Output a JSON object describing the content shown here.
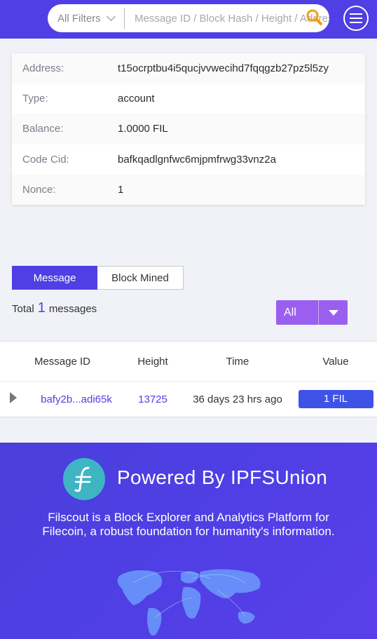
{
  "header": {
    "filter_label": "All Filters",
    "search_placeholder": "Message ID / Block Hash / Height / Address"
  },
  "info": [
    {
      "label": "Address:",
      "value": "t15ocrptbu4i5qucjvvwecihd7fqqgzb27pz5l5zy"
    },
    {
      "label": "Type:",
      "value": "account"
    },
    {
      "label": "Balance:",
      "value": "1.0000 FIL"
    },
    {
      "label": "Code Cid:",
      "value": "bafkqadlgnfwc6mjpmfrwg33vnz2a"
    },
    {
      "label": "Nonce:",
      "value": "1"
    }
  ],
  "tabs": {
    "message": "Message",
    "block_mined": "Block Mined"
  },
  "total": {
    "prefix": "Total",
    "count": "1",
    "suffix": "messages"
  },
  "select": {
    "value": "All"
  },
  "table": {
    "headers": [
      "Message ID",
      "Height",
      "Time",
      "Value"
    ],
    "rows": [
      {
        "message_id": "bafy2b...adi65k",
        "height": "13725",
        "time": "36 days 23 hrs ago",
        "value": "1 FIL"
      }
    ]
  },
  "footer": {
    "powered": "Powered By IPFSUnion",
    "description": "Filscout is a Block Explorer and Analytics Platform for Filecoin, a robust foundation for humanity's information."
  },
  "colors": {
    "brand": "#4f3fe4",
    "select": "#9b5ff0",
    "badge": "#3f52e8",
    "logo": "#3fb5c4"
  }
}
